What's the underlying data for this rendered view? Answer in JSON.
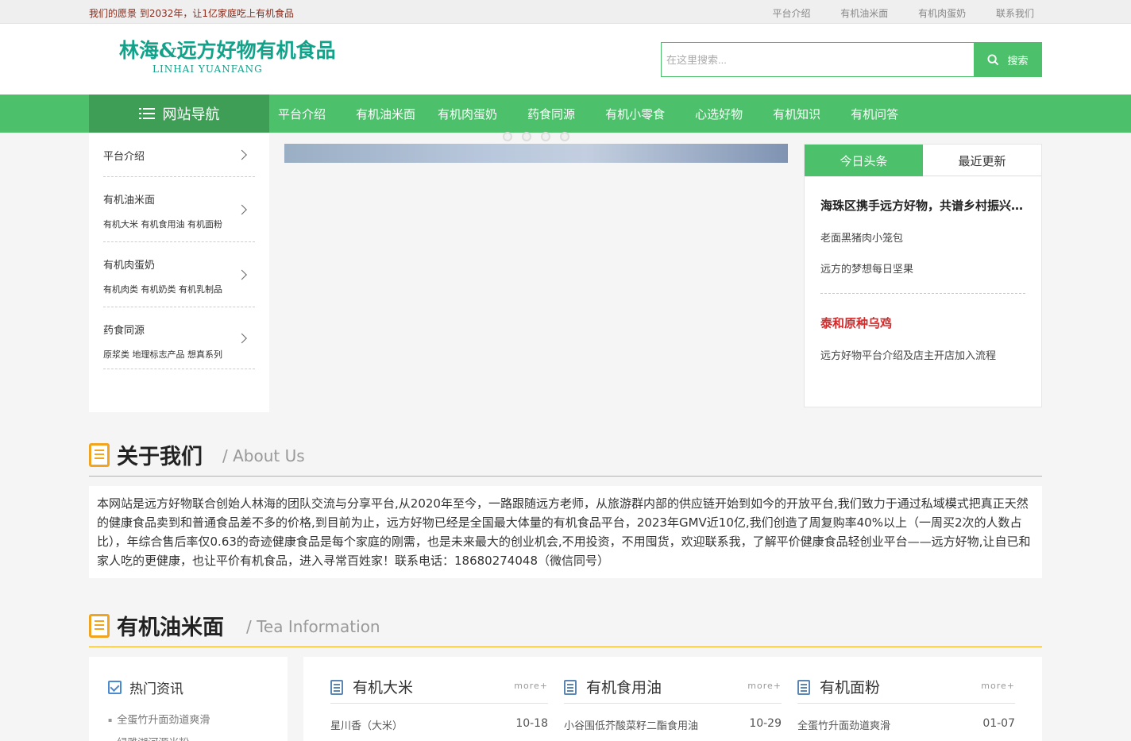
{
  "topbar": {
    "slogan": "我们的愿景 到2032年，让1亿家庭吃上有机食品",
    "links": [
      "平台介绍",
      "有机油米面",
      "有机肉蛋奶",
      "联系我们"
    ]
  },
  "header": {
    "logo_cn": "林海&远方好物有机食品",
    "logo_en": "LINHAI YUANFANG",
    "search_placeholder": "在这里搜索...",
    "search_button": "搜索"
  },
  "nav": {
    "title": "网站导航",
    "items": [
      "平台介绍",
      "有机油米面",
      "有机肉蛋奶",
      "药食同源",
      "有机小零食",
      "心选好物",
      "有机知识",
      "有机问答"
    ]
  },
  "sidebar": {
    "items": [
      {
        "label": "平台介绍",
        "sub": ""
      },
      {
        "label": "有机油米面",
        "sub": "有机大米  有机食用油  有机面粉"
      },
      {
        "label": "有机肉蛋奶",
        "sub": "有机肉类  有机奶类  有机乳制品"
      },
      {
        "label": "药食同源",
        "sub": "原浆类  地理标志产品  想真系列"
      }
    ]
  },
  "news": {
    "tabs": [
      "今日头条",
      "最近更新"
    ],
    "headline": "海珠区携手远方好物，共谱乡村振兴新篇章",
    "items1": [
      "老面黑猪肉小笼包",
      "远方的梦想每日坚果"
    ],
    "headline2": "泰和原种乌鸡",
    "items2": [
      "远方好物平台介绍及店主开店加入流程"
    ]
  },
  "about": {
    "title": "关于我们",
    "subtitle": "/ About Us",
    "text": "本网站是远方好物联合创始人林海的团队交流与分享平台,从2020年至今，一路跟随远方老师，从旅游群内部的供应链开始到如今的开放平台,我们致力于通过私域模式把真正天然的健康食品卖到和普通食品差不多的价格,到目前为止，远方好物已经是全国最大体量的有机食品平台，2023年GMV近10亿,我们创造了周复购率40%以上（一周买2次的人数占比），年综合售后率仅0.63的奇迹健康食品是每个家庭的刚需，也是未来最大的创业机会,不用投资，不用囤货，欢迎联系我，了解平价健康食品轻创业平台——远方好物,让自已和家人吃的更健康，也让平价有机食品，进入寻常百姓家！联系电话：18680274048（微信同号）"
  },
  "organic": {
    "title": "有机油米面",
    "subtitle": "/ Tea Information",
    "hot": {
      "title": "热门资讯",
      "items": [
        "全蛋竹升面劲道爽滑",
        "绿雅湖河源米粉"
      ]
    },
    "cats": [
      {
        "title": "有机大米",
        "more": "more+",
        "row": {
          "text": "星川香（大米）",
          "date": "10-18"
        }
      },
      {
        "title": "有机食用油",
        "more": "more+",
        "row": {
          "text": "小谷围低芥酸菜籽二酯食用油",
          "date": "10-29"
        }
      },
      {
        "title": "有机面粉",
        "more": "more+",
        "row": {
          "text": "全蛋竹升面劲道爽滑",
          "date": "01-07"
        }
      }
    ]
  },
  "colors": {
    "brand_green": "#4cc06a",
    "dark_green": "#3e9e55",
    "accent_orange": "#f0a420",
    "headline_red": "#d62a2a"
  }
}
